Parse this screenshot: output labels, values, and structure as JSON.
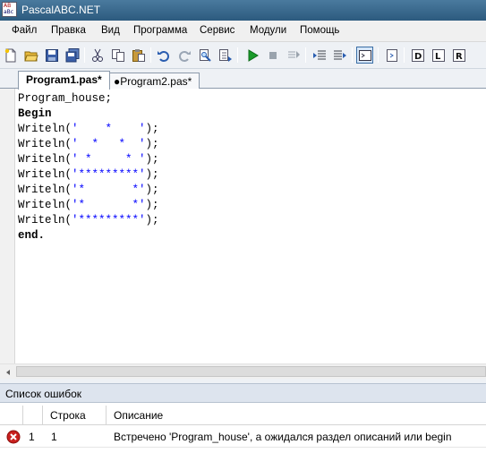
{
  "window": {
    "title": "PascalABC.NET",
    "icon_letters": [
      "AB",
      "aBc"
    ]
  },
  "menu": [
    "Файл",
    "Правка",
    "Вид",
    "Программа",
    "Сервис",
    "Модули",
    "Помощь"
  ],
  "toolbar": {
    "icons": [
      "new-file-icon",
      "open-folder-icon",
      "save-icon",
      "save-all-icon",
      "cut-icon",
      "copy-icon",
      "paste-icon",
      "undo-icon",
      "redo-icon",
      "find-icon",
      "replace-icon",
      "run-icon",
      "stop-icon",
      "step-over-icon",
      "step-into-icon",
      "step-out-icon",
      "output-window-icon",
      "form-designer-icon",
      "debug-d-icon",
      "debug-l-icon",
      "debug-r-icon"
    ]
  },
  "tabs": [
    {
      "label": "Program1.pas*",
      "active": true
    },
    {
      "label": "●Program2.pas*",
      "active": false
    }
  ],
  "editor": {
    "lines": [
      {
        "kw": "",
        "text": "Program_house;"
      },
      {
        "kw": "Begin",
        "text": ""
      },
      {
        "kw": "",
        "text": "Writeln(",
        "str": "'    *    '",
        "end": ");"
      },
      {
        "kw": "",
        "text": "Writeln(",
        "str": "'  *   *  '",
        "end": ");"
      },
      {
        "kw": "",
        "text": "Writeln(",
        "str": "' *     * '",
        "end": ");"
      },
      {
        "kw": "",
        "text": "Writeln(",
        "str": "'*********'",
        "end": ");"
      },
      {
        "kw": "",
        "text": "Writeln(",
        "str": "'*       *'",
        "end": ");"
      },
      {
        "kw": "",
        "text": "Writeln(",
        "str": "'*       *'",
        "end": ");"
      },
      {
        "kw": "",
        "text": "Writeln(",
        "str": "'*********'",
        "end": ");"
      },
      {
        "kw": "end.",
        "text": ""
      }
    ]
  },
  "error_panel": {
    "title": "Список ошибок",
    "columns": [
      "",
      "",
      "Строка",
      "Описание"
    ],
    "rows": [
      {
        "number": "1",
        "line": "1",
        "description": "Встречено 'Program_house', а ожидался раздел описаний или begin"
      }
    ]
  },
  "colors": {
    "string": "#0000ff",
    "titlebar": "#3a6a8e",
    "error_icon": "#c8201e"
  }
}
